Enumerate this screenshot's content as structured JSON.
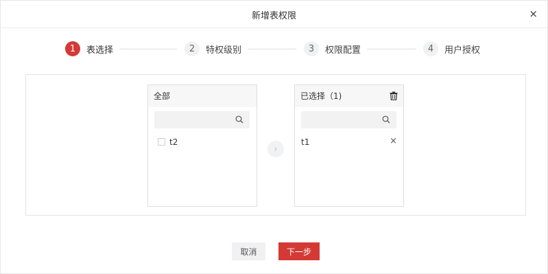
{
  "dialog": {
    "title": "新增表权限",
    "close": "×"
  },
  "steps": [
    {
      "num": "1",
      "label": "表选择",
      "active": true
    },
    {
      "num": "2",
      "label": "特权级别",
      "active": false
    },
    {
      "num": "3",
      "label": "权限配置",
      "active": false
    },
    {
      "num": "4",
      "label": "用户授权",
      "active": false
    }
  ],
  "left_list": {
    "title": "全部",
    "items": [
      "t2"
    ]
  },
  "right_list": {
    "title": "已选择（1)",
    "items": [
      "t1"
    ],
    "remove": "×"
  },
  "transfer": {
    "arrow": "›"
  },
  "footer": {
    "cancel_label": "取消",
    "next_label": "下一步"
  },
  "colors": {
    "accent": "#d33a36"
  },
  "icons": {
    "search": "search-icon",
    "trash": "trash-icon",
    "close": "close-icon"
  }
}
